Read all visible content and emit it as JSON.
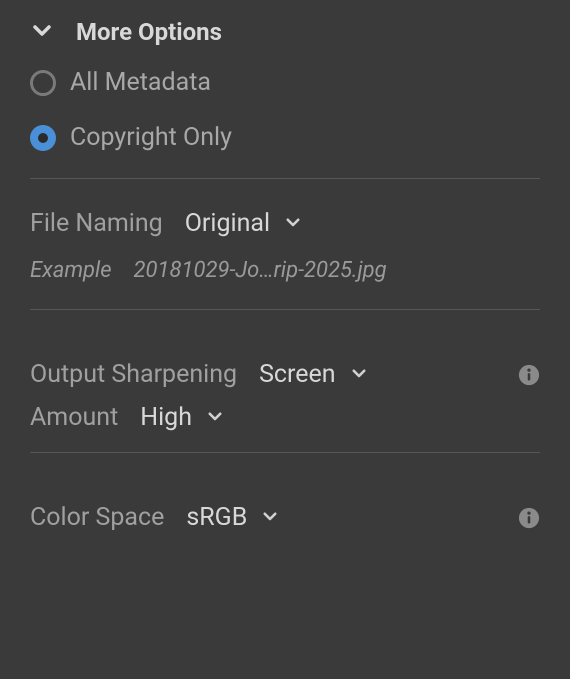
{
  "header": {
    "title": "More Options"
  },
  "metadata": {
    "options": [
      {
        "label": "All Metadata",
        "checked": false
      },
      {
        "label": "Copyright Only",
        "checked": true
      }
    ]
  },
  "fileNaming": {
    "label": "File Naming",
    "selected": "Original",
    "exampleLabel": "Example",
    "exampleValue": "20181029-Jo…rip-2025.jpg"
  },
  "outputSharpening": {
    "label": "Output Sharpening",
    "selected": "Screen",
    "amountLabel": "Amount",
    "amountSelected": "High"
  },
  "colorSpace": {
    "label": "Color Space",
    "selected": "sRGB"
  },
  "colors": {
    "accent": "#4a90d9",
    "text": "#a8a8a8",
    "textBright": "#d8d8d8",
    "divider": "#575757"
  }
}
